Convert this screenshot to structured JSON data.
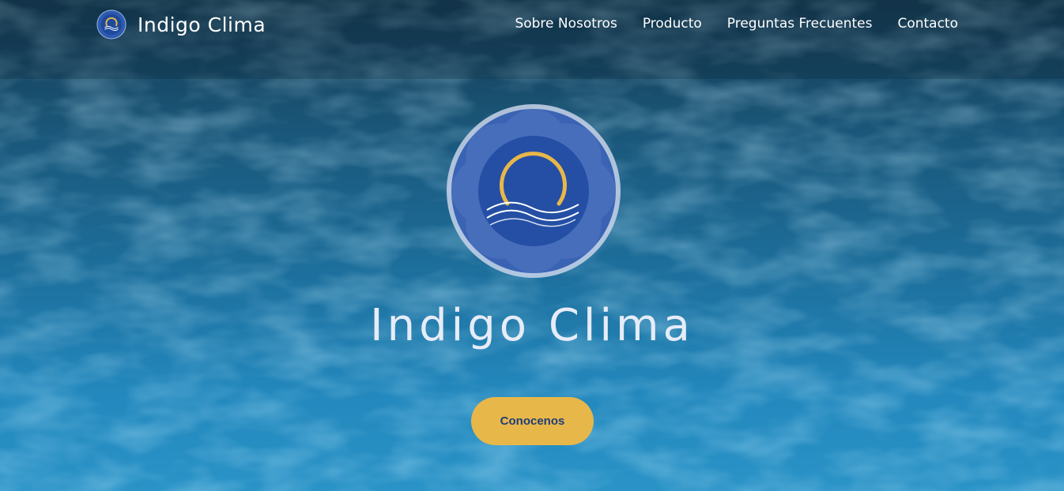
{
  "brand": {
    "name": "Indigo Clima",
    "logo_icon": "indigo-clima-logo-icon"
  },
  "nav": {
    "items": [
      {
        "label": "Sobre Nosotros"
      },
      {
        "label": "Producto"
      },
      {
        "label": "Preguntas Frecuentes"
      },
      {
        "label": "Contacto"
      }
    ]
  },
  "hero": {
    "logo_icon": "indigo-clima-emblem-icon",
    "title": "Indigo Clima",
    "cta_label": "Conocenos"
  },
  "colors": {
    "accent_gold": "#e8b74a",
    "brand_blue": "#1f3d7a",
    "water_dark": "#14384f",
    "water_light": "#2a93c7"
  }
}
